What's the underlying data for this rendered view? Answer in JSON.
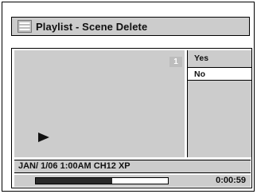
{
  "title_bar": {
    "title": "Playlist - Scene Delete",
    "icon": "playlist-icon"
  },
  "preview": {
    "scene_number": "1",
    "icon": "play-icon"
  },
  "menu": {
    "items": [
      "Yes",
      "No"
    ],
    "selected": "No"
  },
  "info": {
    "text": "JAN/ 1/06 1:00AM CH12 XP"
  },
  "progress": {
    "fraction": 0.58,
    "time": "0:00:59"
  }
}
